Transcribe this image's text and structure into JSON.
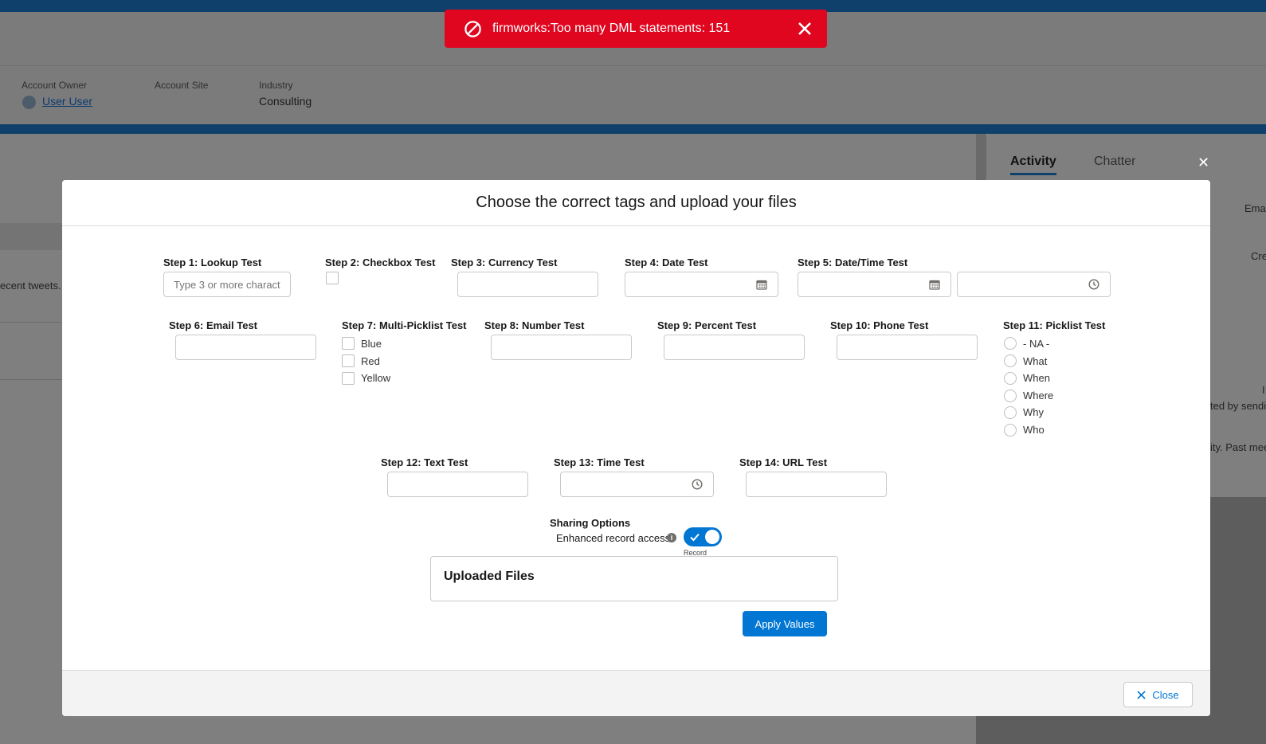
{
  "colors": {
    "brand": "#0176d3",
    "error": "#e0061f",
    "overlay": "#7f7f7f"
  },
  "toast": {
    "message": "firmworks:Too many DML statements: 151",
    "icon": "ban-icon",
    "close_icon": "close-icon"
  },
  "header": {
    "owner_label": "Account Owner",
    "owner_value": "User User",
    "site_label": "Account Site",
    "industry_label": "Industry",
    "industry_value": "Consulting"
  },
  "background": {
    "tweets_text": "ecent tweets.",
    "right_panel": {
      "tabs": [
        "Activity",
        "Chatter"
      ],
      "snippets": [
        "Emai",
        "Cre",
        "I",
        "ted by sendi",
        "ity. Past mee"
      ]
    }
  },
  "modal": {
    "title": "Choose the correct tags and upload your files",
    "steps": {
      "s1": "Step 1: Lookup Test",
      "s1_placeholder": "Type 3 or more charact",
      "s2": "Step 2: Checkbox Test",
      "s3": "Step 3: Currency Test",
      "s4": "Step 4: Date Test",
      "s5": "Step 5: Date/Time Test",
      "s6": "Step 6: Email Test",
      "s7": "Step 7: Multi-Picklist Test",
      "s7_options": [
        "Blue",
        "Red",
        "Yellow"
      ],
      "s8": "Step 8: Number Test",
      "s9": "Step 9: Percent Test",
      "s10": "Step 10: Phone Test",
      "s11": "Step 11: Picklist Test",
      "s11_options": [
        "- NA -",
        "What",
        "When",
        "Where",
        "Why",
        "Who"
      ],
      "s12": "Step 12: Text Test",
      "s13": "Step 13: Time Test",
      "s14": "Step 14: URL Test"
    },
    "sharing": {
      "title": "Sharing Options",
      "label": "Enhanced record access",
      "toggle_caption": "Record",
      "toggle_on": true
    },
    "uploaded_files_title": "Uploaded Files",
    "apply_label": "Apply Values",
    "close_label": "Close"
  }
}
